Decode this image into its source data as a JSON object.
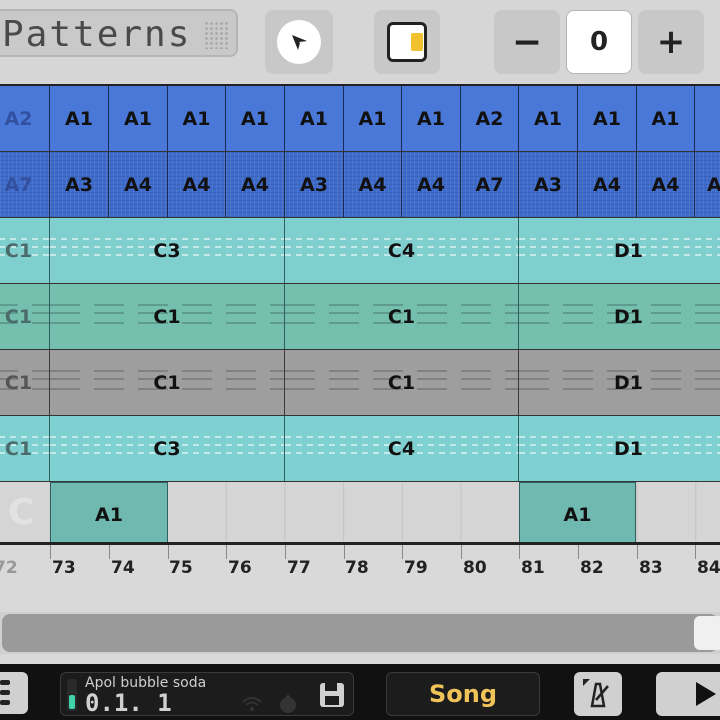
{
  "toolbar": {
    "title": "Patterns",
    "zoom_value": "0",
    "zoom_minus_label": "−",
    "zoom_plus_label": "+"
  },
  "rows": [
    {
      "type": "blue",
      "cells": [
        "A2",
        "A1",
        "A1",
        "A1",
        "A1",
        "A1",
        "A1",
        "A1",
        "A2",
        "A1",
        "A1",
        "A1"
      ]
    },
    {
      "type": "blue2",
      "cells": [
        "A7",
        "A3",
        "A4",
        "A4",
        "A4",
        "A3",
        "A4",
        "A4",
        "A7",
        "A3",
        "A4",
        "A4",
        "A"
      ]
    },
    {
      "type": "teal-a",
      "cells": [
        "C1",
        "C3",
        "C4",
        "D1"
      ]
    },
    {
      "type": "teal-b",
      "cells": [
        "C1",
        "C1",
        "C1",
        "D1"
      ]
    },
    {
      "type": "grey",
      "cells": [
        "C1",
        "C1",
        "C1",
        "D1"
      ]
    },
    {
      "type": "cyan",
      "cells": [
        "C1",
        "C3",
        "C4",
        "D1"
      ]
    },
    {
      "type": "seq",
      "cells": [
        "A1",
        "A1"
      ],
      "ghost": "C"
    }
  ],
  "timeline": {
    "labels": [
      "72",
      "73",
      "74",
      "75",
      "76",
      "77",
      "78",
      "79",
      "80",
      "81",
      "82",
      "83",
      "84"
    ]
  },
  "bottom": {
    "project_name": "Apol bubble soda",
    "position": "0.1. 1",
    "mode_label": "Song"
  }
}
